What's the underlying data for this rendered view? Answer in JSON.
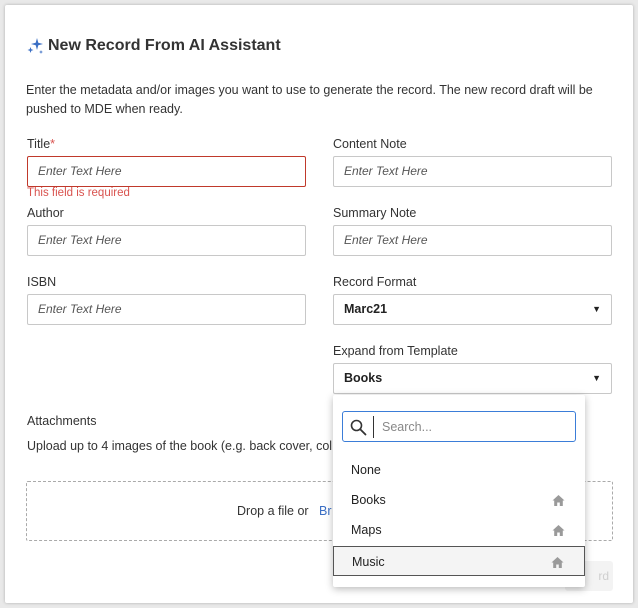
{
  "dialog": {
    "title": "New Record From AI Assistant",
    "description": "Enter the metadata and/or images you want to use to generate the record. The new record draft will be pushed to MDE when ready."
  },
  "form": {
    "title": {
      "label": "Title",
      "required_mark": "*",
      "placeholder": "Enter Text Here",
      "error": "This field is required"
    },
    "author": {
      "label": "Author",
      "placeholder": "Enter Text Here"
    },
    "isbn": {
      "label": "ISBN",
      "placeholder": "Enter Text Here"
    },
    "content_note": {
      "label": "Content Note",
      "placeholder": "Enter Text Here"
    },
    "summary_note": {
      "label": "Summary Note",
      "placeholder": "Enter Text Here"
    },
    "record_format": {
      "label": "Record Format",
      "value": "Marc21"
    },
    "template": {
      "label": "Expand from Template",
      "value": "Books"
    }
  },
  "attachments": {
    "label": "Attachments",
    "hint": "Upload up to 4 images of the book (e.g. back cover, col",
    "drop_text": "Drop a file or",
    "browse_text": "Br"
  },
  "footer": {
    "partial_button": "rd"
  },
  "template_dropdown": {
    "search_placeholder": "Search...",
    "options": [
      {
        "label": "None",
        "icon": ""
      },
      {
        "label": "Books",
        "icon": "home-icon"
      },
      {
        "label": "Maps",
        "icon": "home-icon"
      },
      {
        "label": "Music",
        "icon": "home-icon",
        "selected": true
      }
    ]
  },
  "colors": {
    "accent": "#3b7dd8",
    "error": "#d9534f",
    "sparkle": "#3b6fc4"
  }
}
